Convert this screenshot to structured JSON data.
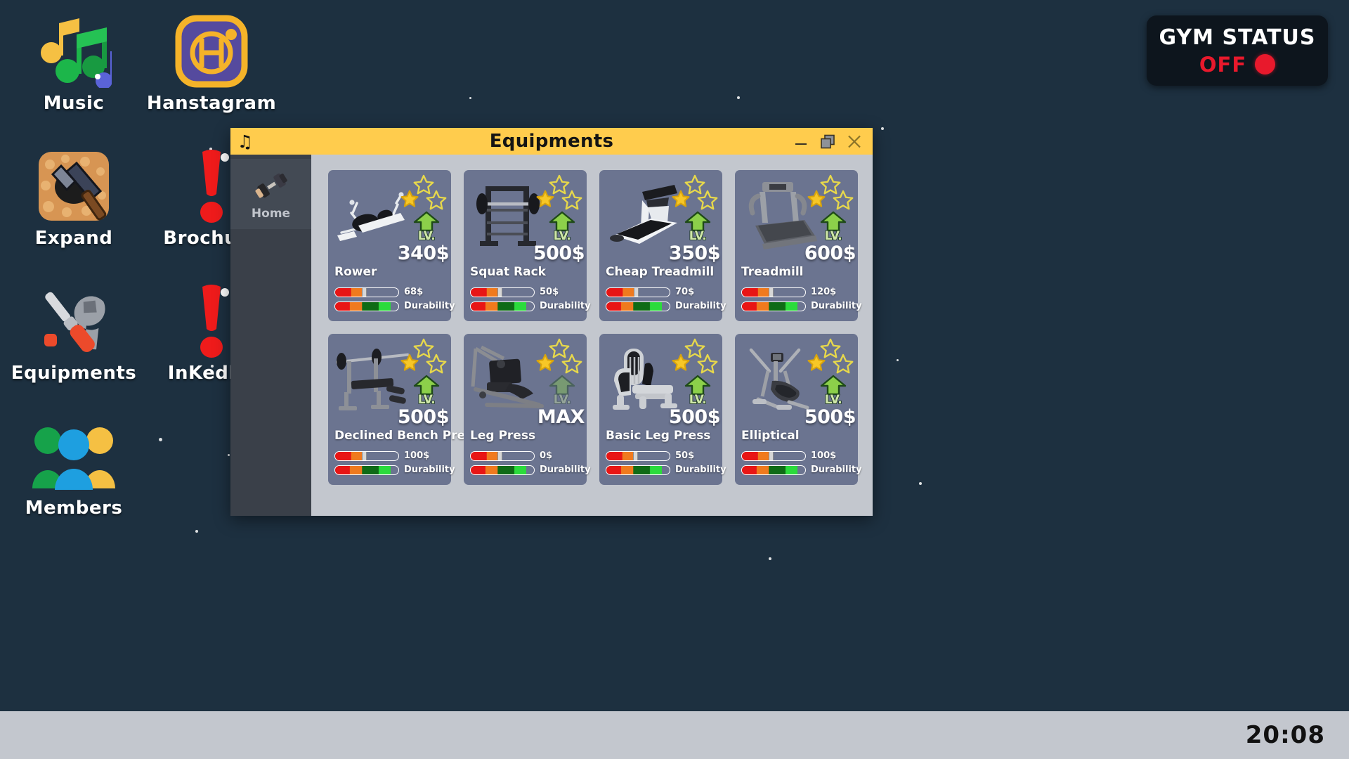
{
  "desktop": {
    "background_color": "#1d3040",
    "icons": [
      {
        "label": "Music",
        "icon": "music-notes-icon"
      },
      {
        "label": "Hanstagram",
        "icon": "hanstagram-icon"
      },
      {
        "label": "Expand",
        "icon": "hammer-rocks-icon"
      },
      {
        "label": "Brochure",
        "icon": "exclamation-mark-icon"
      },
      {
        "label": "Equipments",
        "icon": "wrench-screwdriver-icon"
      },
      {
        "label": "InKedlin",
        "icon": "exclamation-mark-icon"
      },
      {
        "label": "Members",
        "icon": "people-group-icon"
      }
    ]
  },
  "gym_status": {
    "title": "GYM STATUS",
    "value": "OFF",
    "indicator": "red-dot-icon",
    "value_color": "#e8192c"
  },
  "window": {
    "title": "Equipments",
    "icon": "music-note-icon",
    "title_bar_color": "#ffcc4d",
    "controls": [
      {
        "name": "minimize-button",
        "icon": "minimize-icon"
      },
      {
        "name": "restore-button",
        "icon": "restore-icon"
      },
      {
        "name": "close-button",
        "icon": "close-icon"
      }
    ],
    "sidebar": {
      "items": [
        {
          "label": "Home",
          "icon": "dumbbell-icon",
          "active": true
        }
      ]
    },
    "equipment": {
      "durability_label": "Durability",
      "cards": [
        {
          "name": "Rower",
          "price": "340$",
          "upgrade_cost": "68$",
          "stars_filled": 1,
          "stars_total": 3,
          "max_level": false,
          "art": "rower-icon",
          "level_label": "LV.",
          "cond_pct": 45,
          "dur_pct": 88
        },
        {
          "name": "Squat Rack",
          "price": "500$",
          "upgrade_cost": "50$",
          "stars_filled": 1,
          "stars_total": 3,
          "max_level": false,
          "art": "squat-rack-icon",
          "level_label": "LV.",
          "cond_pct": 46,
          "dur_pct": 88
        },
        {
          "name": "Cheap Treadmill",
          "price": "350$",
          "upgrade_cost": "70$",
          "stars_filled": 1,
          "stars_total": 3,
          "max_level": false,
          "art": "treadmill-modern-icon",
          "level_label": "LV.",
          "cond_pct": 47,
          "dur_pct": 88
        },
        {
          "name": "Treadmill",
          "price": "600$",
          "upgrade_cost": "120$",
          "stars_filled": 1,
          "stars_total": 3,
          "max_level": false,
          "art": "treadmill-icon",
          "level_label": "LV.",
          "cond_pct": 45,
          "dur_pct": 88
        },
        {
          "name": "Declined Bench Press",
          "price": "500$",
          "upgrade_cost": "100$",
          "stars_filled": 1,
          "stars_total": 3,
          "max_level": false,
          "art": "bench-press-icon",
          "level_label": "LV.",
          "cond_pct": 45,
          "dur_pct": 88
        },
        {
          "name": "Leg Press",
          "price": "MAX",
          "upgrade_cost": "0$",
          "stars_filled": 1,
          "stars_total": 3,
          "max_level": true,
          "art": "leg-press-icon",
          "level_label": "LV.",
          "cond_pct": 45,
          "dur_pct": 88
        },
        {
          "name": "Basic Leg Press",
          "price": "500$",
          "upgrade_cost": "50$",
          "stars_filled": 1,
          "stars_total": 3,
          "max_level": false,
          "art": "basic-leg-press-icon",
          "level_label": "LV.",
          "cond_pct": 46,
          "dur_pct": 88
        },
        {
          "name": "Elliptical",
          "price": "500$",
          "upgrade_cost": "100$",
          "stars_filled": 1,
          "stars_total": 3,
          "max_level": false,
          "art": "elliptical-icon",
          "level_label": "LV.",
          "cond_pct": 46,
          "dur_pct": 88
        }
      ]
    }
  },
  "taskbar": {
    "clock": "20:08"
  }
}
